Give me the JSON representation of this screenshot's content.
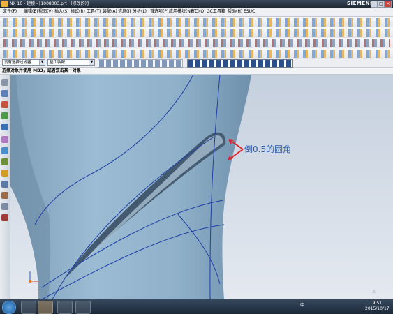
{
  "window": {
    "title": "NX 10 - 建模 - [1008003.prt （修改的）]",
    "brand": "SIEMENS",
    "controls": {
      "minimize": "_",
      "maximize": "□",
      "close": "×"
    }
  },
  "menu": {
    "items": [
      "文件(F)",
      "编辑(E)",
      "视图(V)",
      "插入(S)",
      "格式(R)",
      "工具(T)",
      "装配(A)",
      "信息(I)",
      "分析(L)",
      "首选项(P)",
      "应用模块(N)",
      "窗口(O)",
      "GC工具箱",
      "帮助(H)",
      "ESUC"
    ]
  },
  "selection_bar": {
    "filter_value": "没有选择过滤器",
    "scope_value": "整个装配"
  },
  "prompt": "选择对象并使用 MB3，或者双击某一对象",
  "annotation": {
    "text": "倒0.5的圆角",
    "color": "#d8232a"
  },
  "taskbar": {
    "tray_text": "中",
    "time": "9:51",
    "date": "2015/10/17"
  },
  "colors": {
    "accent": "#2b5db5",
    "model": "#8eb2cc",
    "background_top": "#c7d2e0",
    "background_bottom": "#e2e8f0",
    "curve": "#1f3fa8"
  }
}
